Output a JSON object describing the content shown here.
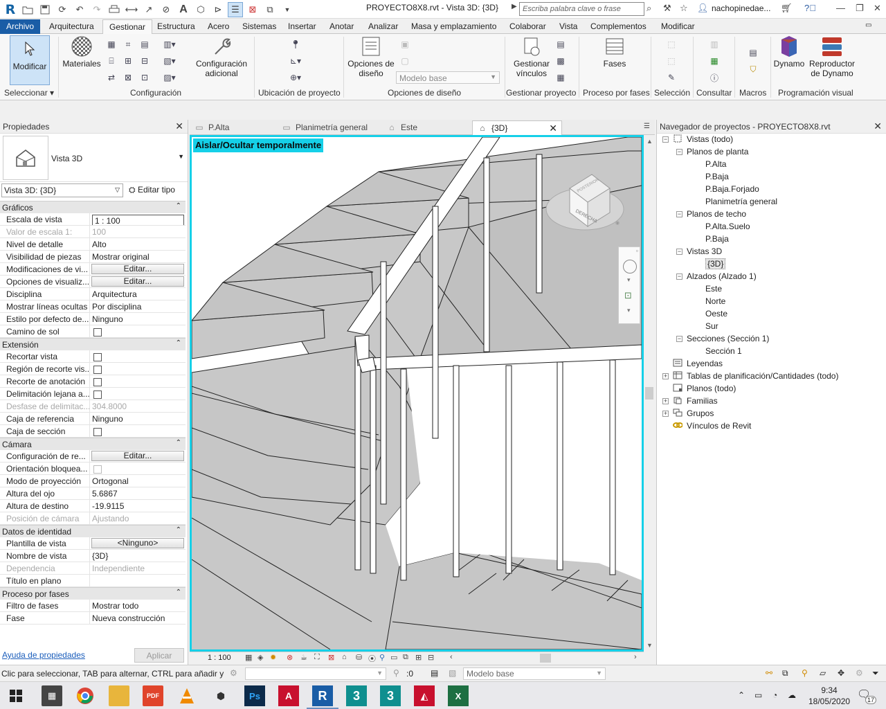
{
  "titlebar": {
    "doc_title": "PROYECTO8X8.rvt - Vista 3D: {3D}",
    "search_placeholder": "Escriba palabra clave o frase",
    "user": "nachopinedae..."
  },
  "ribbon_tabs": [
    "Archivo",
    "Arquitectura",
    "Gestionar",
    "Estructura",
    "Acero",
    "Sistemas",
    "Insertar",
    "Anotar",
    "Analizar",
    "Masa y emplazamiento",
    "Colaborar",
    "Vista",
    "Complementos",
    "Modificar"
  ],
  "active_ribbon_tab": "Gestionar",
  "ribbon": {
    "modify_label": "Modificar",
    "materials_label": "Materiales",
    "addl_settings_label": "Configuración\nadicional",
    "design_options_label": "Opciones de\ndiseño",
    "model_base": "Modelo base",
    "manage_links_label": "Gestionar\nvínculos",
    "phases_label": "Fases",
    "dynamo_label": "Dynamo",
    "dynamo_player_label": "Reproductor\nde Dynamo",
    "groups": {
      "select": "Seleccionar",
      "settings": "Configuración",
      "project_location": "Ubicación de proyecto",
      "design_options": "Opciones de diseño",
      "manage_project": "Gestionar proyecto",
      "phasing": "Proceso por fases",
      "selection": "Selección",
      "inquiry": "Consultar",
      "macros": "Macros",
      "visual_programming": "Programación visual"
    }
  },
  "properties": {
    "title": "Propiedades",
    "type_name": "Vista 3D",
    "instance": "Vista 3D: {3D}",
    "edit_type": "Editar tipo",
    "groups": [
      {
        "name": "Gráficos",
        "rows": [
          {
            "k": "Escala de vista",
            "v": "1 : 100",
            "kind": "boxed"
          },
          {
            "k": "Valor de escala    1:",
            "v": "100",
            "kind": "dis"
          },
          {
            "k": "Nivel de detalle",
            "v": "Alto"
          },
          {
            "k": "Visibilidad de piezas",
            "v": "Mostrar original"
          },
          {
            "k": "Modificaciones de vi...",
            "v": "Editar...",
            "kind": "btn"
          },
          {
            "k": "Opciones de visualiz...",
            "v": "Editar...",
            "kind": "btn"
          },
          {
            "k": "Disciplina",
            "v": "Arquitectura"
          },
          {
            "k": "Mostrar líneas ocultas",
            "v": "Por disciplina"
          },
          {
            "k": "Estilo por defecto de...",
            "v": "Ninguno"
          },
          {
            "k": "Camino de sol",
            "v": "",
            "kind": "chk"
          }
        ]
      },
      {
        "name": "Extensión",
        "rows": [
          {
            "k": "Recortar vista",
            "v": "",
            "kind": "chk"
          },
          {
            "k": "Región de recorte vis...",
            "v": "",
            "kind": "chk"
          },
          {
            "k": "Recorte de anotación",
            "v": "",
            "kind": "chk"
          },
          {
            "k": "Delimitación lejana a...",
            "v": "",
            "kind": "chk"
          },
          {
            "k": "Desfase de delimitac...",
            "v": "304.8000",
            "kind": "dis"
          },
          {
            "k": "Caja de referencia",
            "v": "Ninguno"
          },
          {
            "k": "Caja de sección",
            "v": "",
            "kind": "chk"
          }
        ]
      },
      {
        "name": "Cámara",
        "rows": [
          {
            "k": "Configuración de re...",
            "v": "Editar...",
            "kind": "btn"
          },
          {
            "k": "Orientación bloquea...",
            "v": "",
            "kind": "chkdis"
          },
          {
            "k": "Modo de proyección",
            "v": "Ortogonal"
          },
          {
            "k": "Altura del ojo",
            "v": "5.6867"
          },
          {
            "k": "Altura de destino",
            "v": "-19.9115"
          },
          {
            "k": "Posición de cámara",
            "v": "Ajustando",
            "kind": "dis"
          }
        ]
      },
      {
        "name": "Datos de identidad",
        "rows": [
          {
            "k": "Plantilla de vista",
            "v": "<Ninguno>",
            "kind": "btn"
          },
          {
            "k": "Nombre de vista",
            "v": "{3D}"
          },
          {
            "k": "Dependencia",
            "v": "Independiente",
            "kind": "dis"
          },
          {
            "k": "Título en plano",
            "v": ""
          }
        ]
      },
      {
        "name": "Proceso por fases",
        "rows": [
          {
            "k": "Filtro de fases",
            "v": "Mostrar todo"
          },
          {
            "k": "Fase",
            "v": "Nueva construcción"
          }
        ]
      }
    ],
    "help_link": "Ayuda de propiedades",
    "apply": "Aplicar"
  },
  "view_tabs": [
    {
      "label": "P.Alta",
      "icon": "floor-plan-icon"
    },
    {
      "label": "Planimetría general",
      "icon": "floor-plan-icon"
    },
    {
      "label": "Este",
      "icon": "elevation-icon"
    },
    {
      "label": "{3D}",
      "icon": "3d-view-icon",
      "active": true
    }
  ],
  "viewport": {
    "isolate_label": "Aislar/Ocultar temporalmente",
    "scale": "1 : 100",
    "viewcube_front": "DERECHA",
    "viewcube_top": "POSTERIOR"
  },
  "browser": {
    "title": "Navegador de proyectos - PROYECTO8X8.rvt",
    "nodes": [
      {
        "label": "Vistas (todo)",
        "level": 0,
        "tog": "-",
        "icon": "views"
      },
      {
        "label": "Planos de planta",
        "level": 1,
        "tog": "-"
      },
      {
        "label": "P.Alta",
        "level": 2
      },
      {
        "label": "P.Baja",
        "level": 2
      },
      {
        "label": "P.Baja.Forjado",
        "level": 2
      },
      {
        "label": "Planimetría general",
        "level": 2
      },
      {
        "label": "Planos de techo",
        "level": 1,
        "tog": "-"
      },
      {
        "label": "P.Alta.Suelo",
        "level": 2
      },
      {
        "label": "P.Baja",
        "level": 2
      },
      {
        "label": "Vistas 3D",
        "level": 1,
        "tog": "-"
      },
      {
        "label": "{3D}",
        "level": 2,
        "selected": true
      },
      {
        "label": "Alzados (Alzado 1)",
        "level": 1,
        "tog": "-"
      },
      {
        "label": "Este",
        "level": 2
      },
      {
        "label": "Norte",
        "level": 2
      },
      {
        "label": "Oeste",
        "level": 2
      },
      {
        "label": "Sur",
        "level": 2
      },
      {
        "label": "Secciones (Sección 1)",
        "level": 1,
        "tog": "-"
      },
      {
        "label": "Sección 1",
        "level": 2
      },
      {
        "label": "Leyendas",
        "level": 0,
        "icon": "legend"
      },
      {
        "label": "Tablas de planificación/Cantidades (todo)",
        "level": 0,
        "tog": "+",
        "icon": "schedule"
      },
      {
        "label": "Planos (todo)",
        "level": 0,
        "icon": "sheet"
      },
      {
        "label": "Familias",
        "level": 0,
        "tog": "+",
        "icon": "family"
      },
      {
        "label": "Grupos",
        "level": 0,
        "tog": "+",
        "icon": "group"
      },
      {
        "label": "Vínculos de Revit",
        "level": 0,
        "icon": "link"
      }
    ]
  },
  "statusbar": {
    "message": "Clic para seleccionar, TAB para alternar, CTRL para añadir y MAYÚS para desmarcar.",
    "zero": ":0",
    "model_base": "Modelo base"
  },
  "taskbar": {
    "time": "9:34",
    "date": "18/05/2020",
    "notif_count": "17"
  }
}
